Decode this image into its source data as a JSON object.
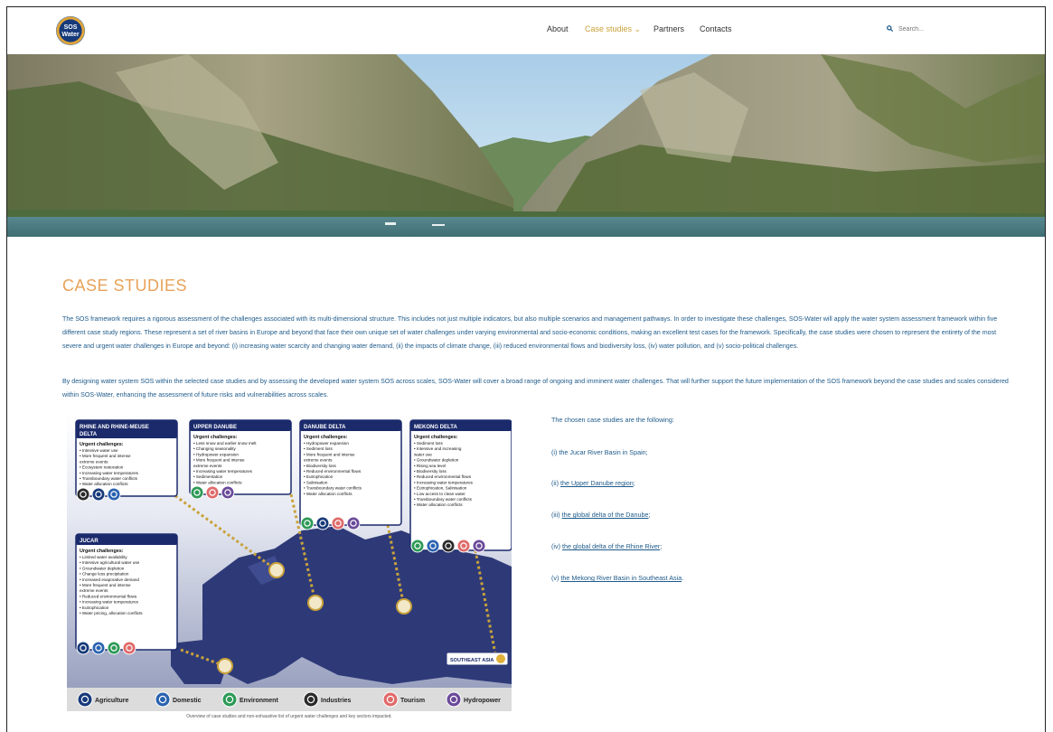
{
  "header": {
    "logo": {
      "line1": "SOS",
      "line2": "Water"
    },
    "nav": {
      "about": "About",
      "case_studies": "Case studies ⌄",
      "partners": "Partners",
      "contacts": "Contacts"
    },
    "search": {
      "icon": "search-icon",
      "placeholder": "Search..."
    }
  },
  "page": {
    "title": "CASE STUDIES",
    "paragraph1": "The SOS framework requires a rigorous assessment of the challenges associated with its multi-dimensional structure. This includes not just multiple indicators, but also multiple scenarios and management pathways. In order to investigate these challenges, SOS-Water will apply the water system assessment framework within five different case study regions. These represent a set of river basins in Europe and beyond that face their own unique set of water challenges under varying environmental and socio-economic conditions, making an excellent test cases for the framework. Specifically, the case studies were chosen to represent the entirety of the most severe and urgent water challenges in Europe and beyond: (i) increasing water scarcity and changing water demand, (ii) the impacts of climate change, (iii) reduced environmental flows and biodiversity loss, (iv) water pollution, and (v) socio-political challenges.",
    "paragraph2": "By designing water system SOS within the selected case studies and by assessing the developed water system SOS across scales, SOS-Water will cover a broad range of ongoing and imminent water challenges. That will further support the future implementation of the SOS framework beyond the case studies and scales considered within SOS-Water, enhancing the assessment of future risks and vulnerabilities across scales.",
    "caption": "Overview of case studies and non-exhaustive list of urgent water challenges and key sectors impacted."
  },
  "infographic": {
    "urgent_label": "Urgent challenges:",
    "boxes": [
      {
        "title": "RHINE AND RHINE-MEUSE",
        "title2": "DELTA",
        "items": [
          "• Intensive water use",
          "• More frequent and intense",
          "extreme events",
          "• Ecosystem restoration",
          "• Increasing water temperatures",
          "• Transboundary water conflicts",
          "• Water allocation conflicts"
        ]
      },
      {
        "title": "UPPER DANUBE",
        "items": [
          "• Less snow and earlier snow melt",
          "• Changing seasonality",
          "• Hydropower expansion",
          "• More frequent and intense",
          "extreme events",
          "• Increasing water temperatures",
          "• Sedimentation",
          "• Water allocation conflicts"
        ]
      },
      {
        "title": "DANUBE DELTA",
        "items": [
          "• Hydropower expansion",
          "• Sediment loss",
          "• More frequent and intense",
          "extreme events",
          "• Biodiversity loss",
          "• Reduced environmental flows",
          "• Eutrophication",
          "• Salinisation",
          "• Transboundary water conflicts",
          "• Water allocation conflicts"
        ]
      },
      {
        "title": "MEKONG DELTA",
        "items": [
          "• Sediment loss",
          "• Intensive and increasing",
          "water use",
          "• Groundwater depletion",
          "• Rising sea level",
          "• Biodiversity loss",
          "• Reduced environmental flows",
          "• Increasing water temperatures",
          "• Eutrophication, Salinisation",
          "• Low access to clean water",
          "• Transboundary water conflicts",
          "• Water allocation conflicts"
        ]
      },
      {
        "title": "JUCAR",
        "items": [
          "• Limited water availability",
          "• Intensive agricultural water use",
          "• Groundwater depletion",
          "• Change less precipitation",
          "• Increased evaporative demand",
          "• More frequent and intense",
          "extreme events",
          "• Reduced environmental flows",
          "• Increasing water temperatures",
          "• Eutrophication",
          "• Water pricing, allocation conflicts"
        ]
      }
    ],
    "southeast_asia": "SOUTHEAST ASIA",
    "legend": [
      "Agriculture",
      "Domestic",
      "Environment",
      "Industries",
      "Tourism",
      "Hydropower"
    ],
    "colors": {
      "agriculture": "#173a7a",
      "domestic": "#2b63b0",
      "environment": "#2e9a57",
      "industries": "#2a2a2a",
      "tourism": "#e06a6a",
      "hydropower": "#6b4a9a"
    }
  },
  "list": {
    "intro": "The chosen case studies are the following:",
    "i_prefix": "(i) ",
    "i_text": "the Jucar River Basin in Spain;",
    "ii_prefix": "(ii) ",
    "ii_link": "the Upper Danube region",
    "iii_prefix": "(iii) ",
    "iii_link": "the global delta of the Danube",
    "iv_prefix": "(iv) ",
    "iv_link": "the global delta of the Rhine River",
    "v_prefix": "(v) ",
    "v_link": "the Mekong River Basin in Southeast Asia"
  }
}
